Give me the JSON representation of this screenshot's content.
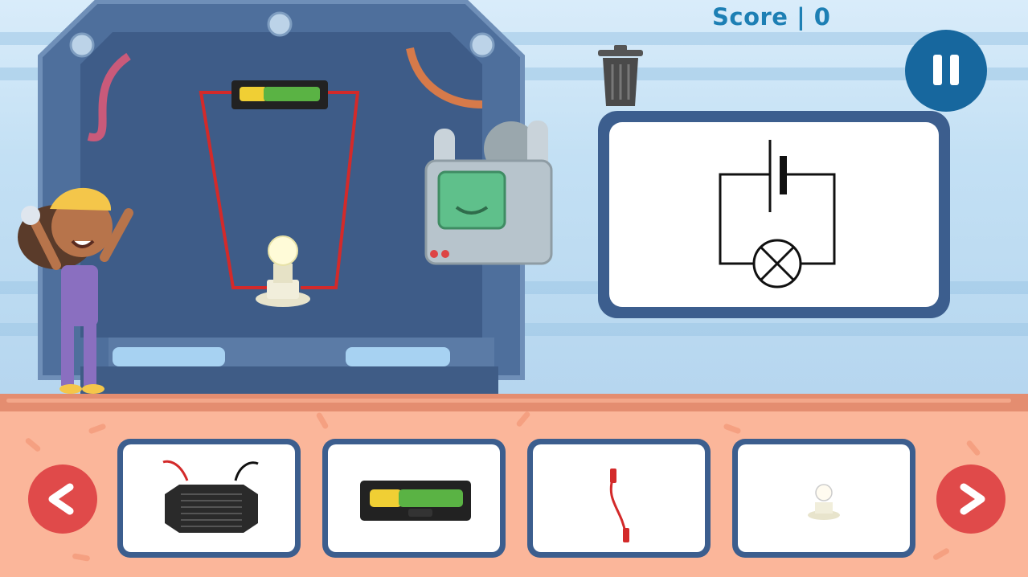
{
  "hud": {
    "score_text": "Score | 0"
  },
  "controls": {
    "pause_icon": "pause-icon",
    "trash_icon": "trash-can-icon",
    "prev_icon": "chevron-left-icon",
    "next_icon": "chevron-right-icon"
  },
  "target_diagram": {
    "components": [
      "cell-symbol",
      "lamp-symbol"
    ]
  },
  "workbench": {
    "placed_parts": [
      "battery-holder",
      "light-bulb",
      "wire",
      "wire"
    ]
  },
  "inventory": {
    "items": [
      {
        "name": "buzzer-item"
      },
      {
        "name": "battery-item"
      },
      {
        "name": "wire-item"
      },
      {
        "name": "bulb-item"
      }
    ]
  },
  "colors": {
    "score": "#1d7fb4",
    "pause_button": "#17679e",
    "card_border": "#3c5e8e",
    "nav_button": "#e04a4a",
    "floor": "#fbb69a",
    "wire": "#d32a2a"
  }
}
